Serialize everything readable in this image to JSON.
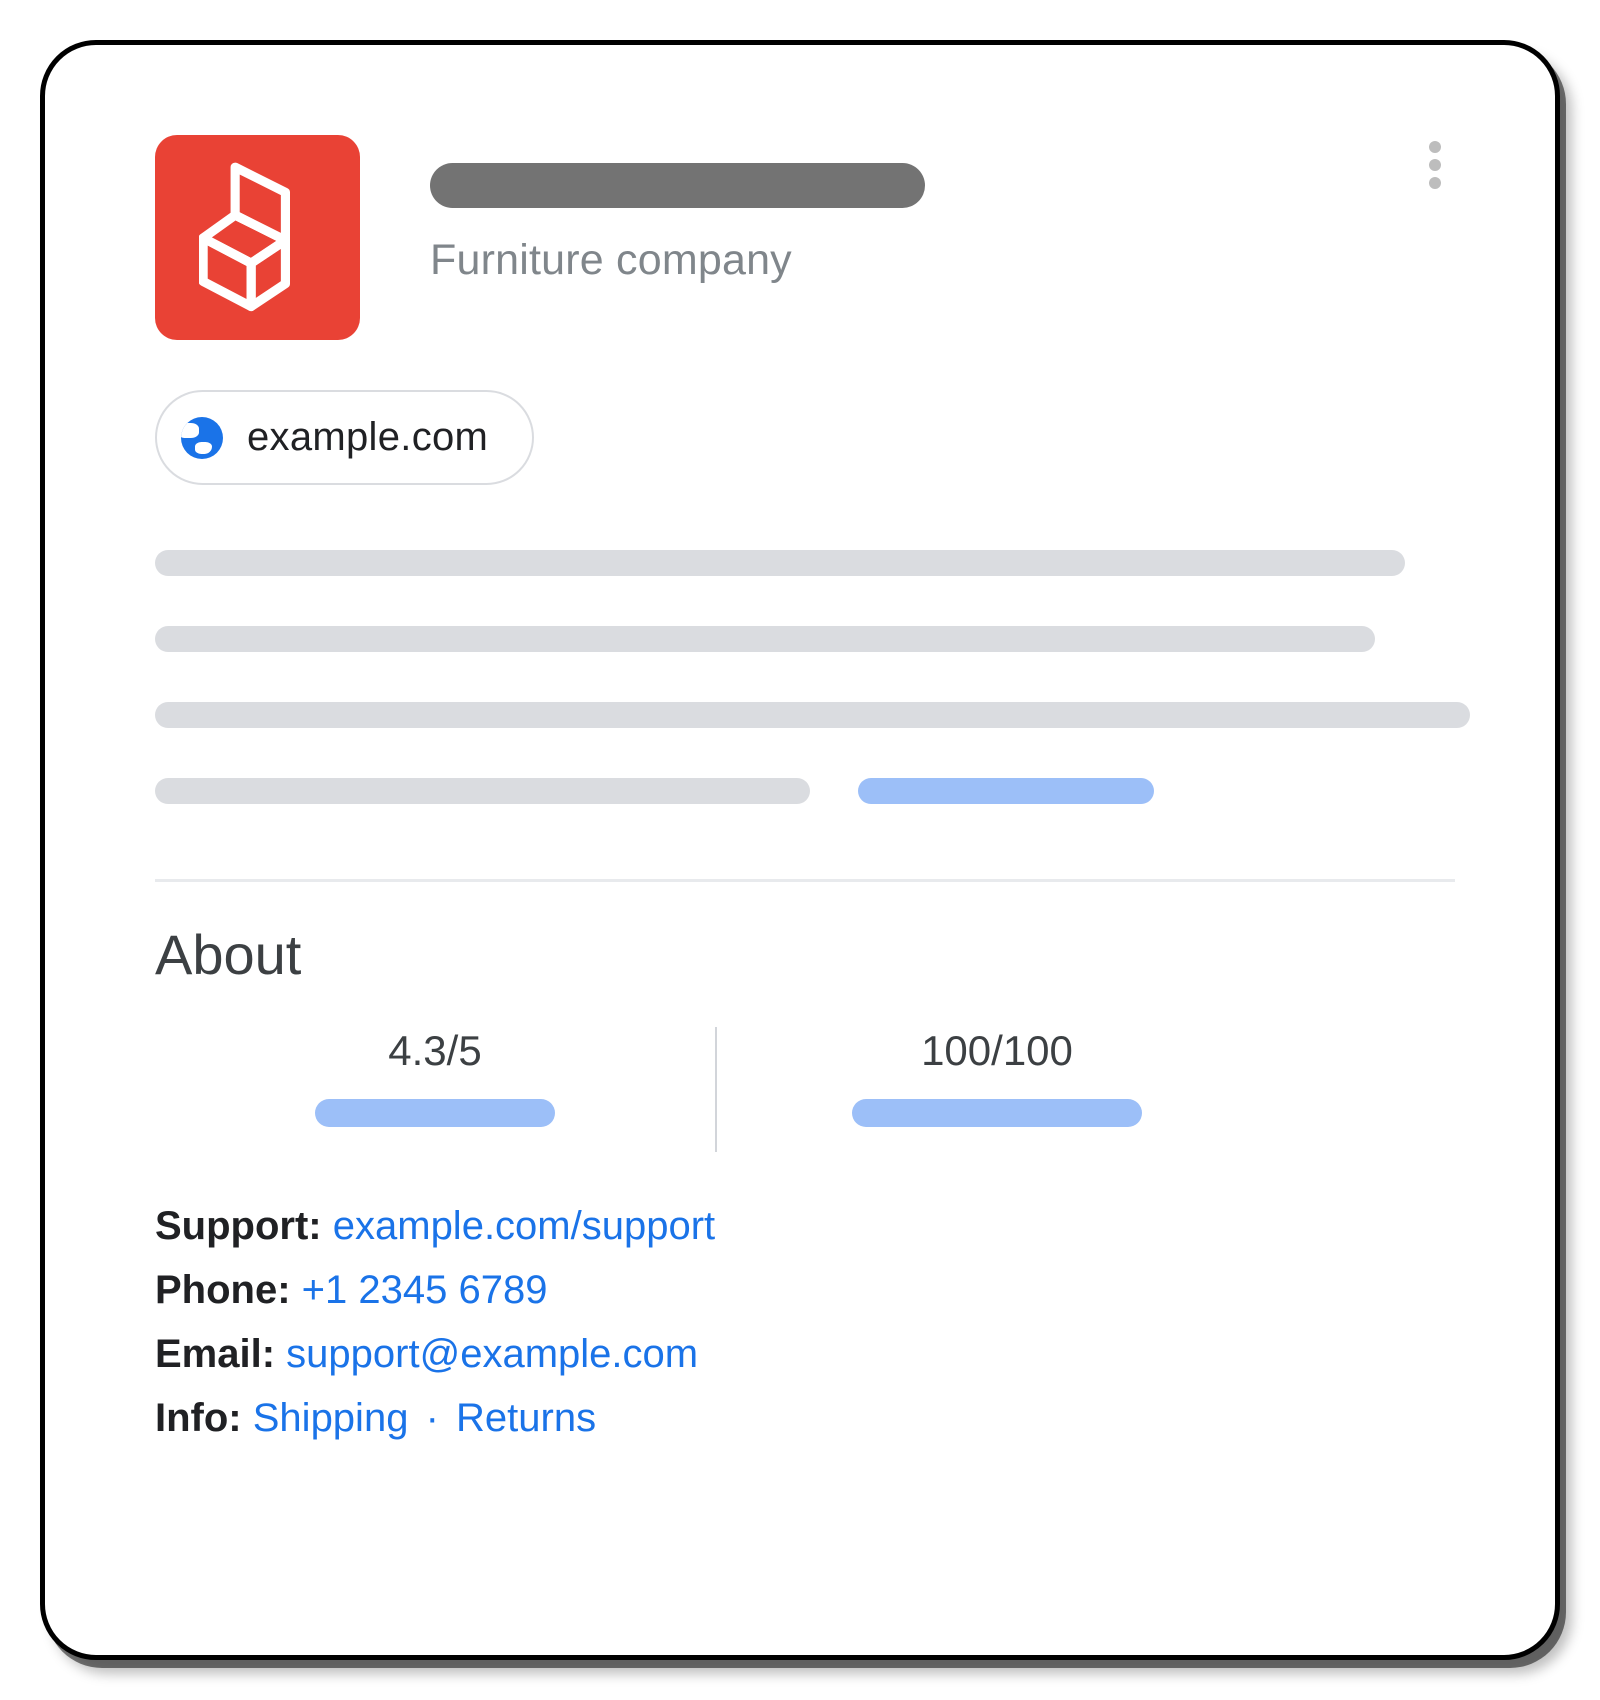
{
  "header": {
    "subtitle": "Furniture company"
  },
  "website_chip": {
    "domain": "example.com"
  },
  "about": {
    "title": "About",
    "metrics": {
      "rating": "4.3/5",
      "score": "100/100"
    }
  },
  "contact": {
    "support": {
      "label": "Support:",
      "link_text": "example.com/support"
    },
    "phone": {
      "label": "Phone:",
      "link_text": "+1 2345 6789"
    },
    "email": {
      "label": "Email:",
      "link_text": "support@example.com"
    },
    "info": {
      "label": "Info:",
      "shipping_text": "Shipping",
      "separator": "·",
      "returns_text": "Returns"
    }
  }
}
